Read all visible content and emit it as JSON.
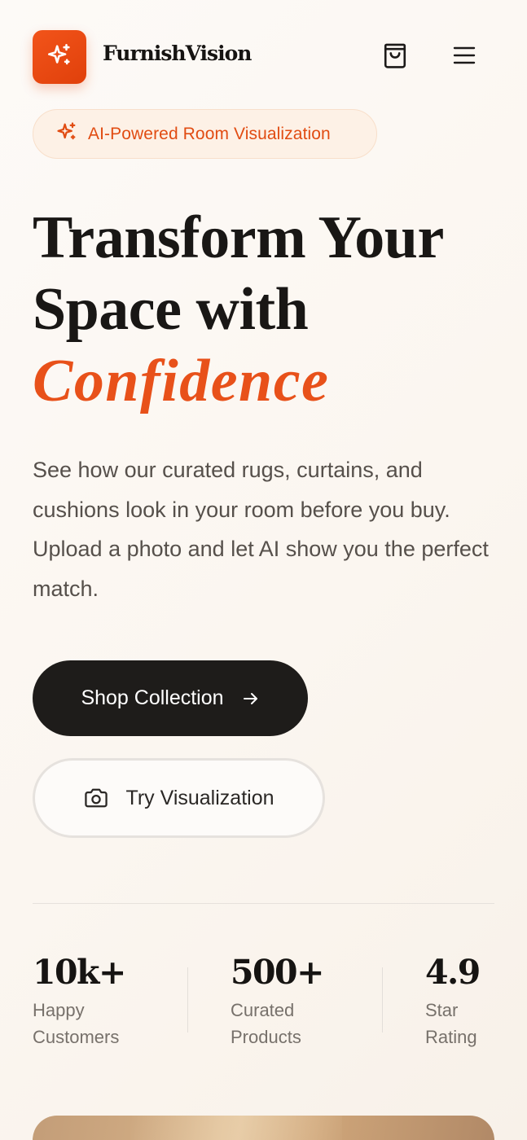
{
  "header": {
    "brand": "FurnishVision",
    "logo_icon": "sparkles-icon",
    "cart_icon": "shopping-bag-icon",
    "menu_icon": "hamburger-menu-icon"
  },
  "badge": {
    "icon": "sparkles-icon",
    "text": "AI-Powered Room Visualization"
  },
  "hero": {
    "title_line1": "Transform Your",
    "title_line2": "Space with",
    "title_accent": "Confidence",
    "description": "See how our curated rugs, curtains, and cushions look in your room before you buy. Upload a photo and let AI show you the perfect match."
  },
  "buttons": {
    "primary_label": "Shop Collection",
    "primary_icon": "arrow-right-icon",
    "secondary_label": "Try Visualization",
    "secondary_icon": "camera-icon"
  },
  "stats": [
    {
      "value": "10k+",
      "label_line1": "Happy",
      "label_line2": "Customers"
    },
    {
      "value": "500+",
      "label_line1": "Curated",
      "label_line2": "Products"
    },
    {
      "value": "4.9",
      "label_line1": "Star",
      "label_line2": "Rating"
    }
  ],
  "colors": {
    "accent": "#e8511a",
    "dark": "#1e1c1a",
    "background": "#fbf6f0"
  }
}
